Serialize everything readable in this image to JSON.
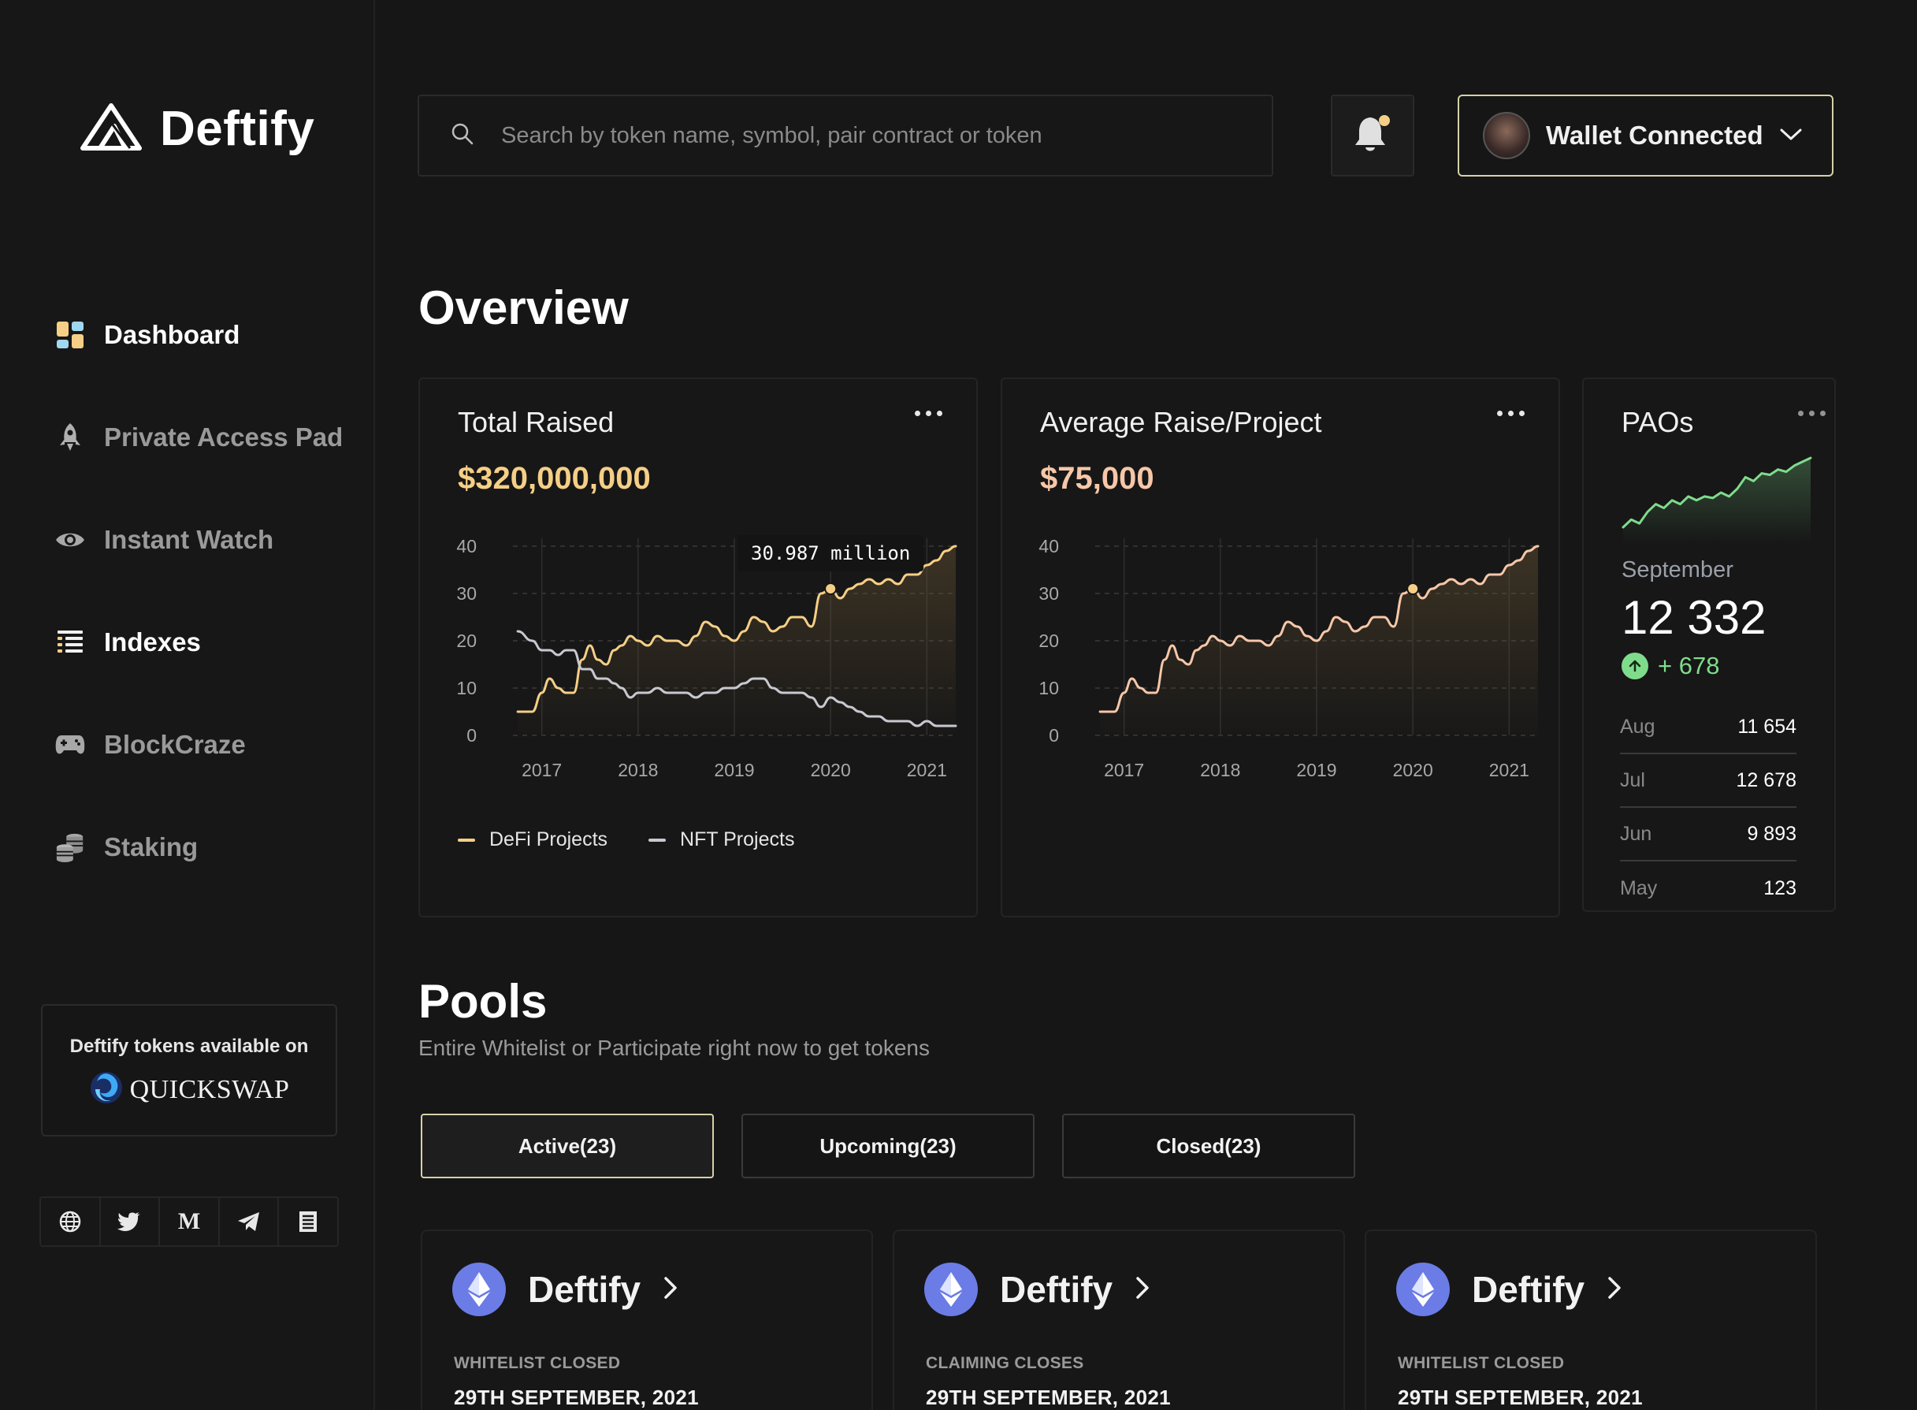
{
  "brand": {
    "name": "Deftify"
  },
  "search": {
    "placeholder": "Search by token name, symbol, pair contract or token"
  },
  "wallet": {
    "label": "Wallet Connected"
  },
  "nav": [
    {
      "label": "Dashboard",
      "icon": "dashboard-icon",
      "active": true
    },
    {
      "label": "Private Access Pad",
      "icon": "rocket-icon",
      "active": false
    },
    {
      "label": "Instant Watch",
      "icon": "eye-icon",
      "active": false
    },
    {
      "label": "Indexes",
      "icon": "list-icon",
      "active": true
    },
    {
      "label": "BlockCraze",
      "icon": "gamepad-icon",
      "active": false
    },
    {
      "label": "Staking",
      "icon": "coins-icon",
      "active": false
    }
  ],
  "promo": {
    "text": "Deftify tokens available on",
    "partner": "QUICKSWAP"
  },
  "socials": [
    "globe-icon",
    "twitter-icon",
    "medium-icon",
    "telegram-icon",
    "document-icon"
  ],
  "overview": {
    "title": "Overview",
    "total_raised": {
      "title": "Total Raised",
      "value": "$320,000,000",
      "tooltip": "30.987 million"
    },
    "avg_raise": {
      "title": "Average Raise/Project",
      "value": "$75,000"
    },
    "paos": {
      "title": "PAOs",
      "month": "September",
      "value": "12 332",
      "change": "+ 678",
      "rows": [
        {
          "month": "Aug",
          "value": "11 654"
        },
        {
          "month": "Jul",
          "value": "12 678"
        },
        {
          "month": "Jun",
          "value": "9 893"
        },
        {
          "month": "May",
          "value": "123"
        }
      ]
    }
  },
  "pools": {
    "title": "Pools",
    "subtitle": "Entire Whitelist or Participate right now to get tokens",
    "tabs": [
      {
        "label": "Active(23)",
        "active": true
      },
      {
        "label": "Upcoming(23)",
        "active": false
      },
      {
        "label": "Closed(23)",
        "active": false
      }
    ],
    "cards": [
      {
        "name": "Deftify",
        "status": "WHITELIST CLOSED",
        "date": "29TH SEPTEMBER, 2021"
      },
      {
        "name": "Deftify",
        "status": "CLAIMING CLOSES",
        "date": "29TH SEPTEMBER, 2021"
      },
      {
        "name": "Deftify",
        "status": "WHITELIST CLOSED",
        "date": "29TH SEPTEMBER, 2021"
      }
    ]
  },
  "colors": {
    "accent_gold": "#f5cf86",
    "accent_peach": "#f6c7a8",
    "line_nft": "#c8c8d0",
    "positive": "#7fdc8c",
    "eth_blue": "#6b7ce6"
  },
  "chart_data": [
    {
      "type": "line",
      "title": "Total Raised",
      "x": [
        2016.75,
        2016.9,
        2017.0,
        2017.08,
        2017.17,
        2017.25,
        2017.33,
        2017.42,
        2017.5,
        2017.58,
        2017.67,
        2017.75,
        2017.83,
        2017.92,
        2018.0,
        2018.1,
        2018.2,
        2018.3,
        2018.4,
        2018.5,
        2018.6,
        2018.7,
        2018.8,
        2018.9,
        2019.0,
        2019.1,
        2019.2,
        2019.3,
        2019.4,
        2019.5,
        2019.6,
        2019.7,
        2019.8,
        2019.9,
        2020.0,
        2020.1,
        2020.2,
        2020.3,
        2020.4,
        2020.5,
        2020.6,
        2020.7,
        2020.8,
        2020.9,
        2021.0,
        2021.1,
        2021.2,
        2021.3
      ],
      "series": [
        {
          "name": "DeFi Projects",
          "values": [
            5,
            5,
            9,
            12,
            10,
            9,
            9,
            16,
            19,
            16,
            15,
            18,
            19,
            21,
            20,
            19,
            21,
            20,
            20,
            19,
            21,
            24,
            23,
            21,
            20,
            22,
            25,
            24,
            22,
            23,
            25,
            25,
            23,
            30,
            31,
            29,
            31,
            32,
            33,
            32,
            33,
            32,
            34,
            34,
            36,
            37,
            39,
            40
          ]
        },
        {
          "name": "NFT Projects",
          "values": [
            22,
            20,
            18,
            18,
            17,
            18,
            18,
            14,
            14,
            12,
            12,
            11,
            10,
            8,
            9,
            9,
            10,
            9,
            9,
            9,
            8,
            9,
            9,
            10,
            10,
            11,
            12,
            12,
            10,
            9,
            9,
            9,
            8,
            6,
            8,
            7,
            6,
            5,
            4,
            4,
            3,
            3,
            3,
            2,
            3,
            2,
            2,
            2
          ]
        }
      ],
      "highlight": {
        "x": 2020.0,
        "y": 31,
        "label": "30.987 million"
      },
      "ylim": [
        0,
        40
      ],
      "yticks": [
        0,
        10,
        20,
        30,
        40
      ],
      "xticks": [
        2017,
        2018,
        2019,
        2020,
        2021
      ],
      "xlim": [
        2016.7,
        2021.3
      ],
      "grid": true,
      "legend": "bottom-left"
    },
    {
      "type": "area",
      "title": "Average Raise/Project",
      "x": [
        2016.75,
        2016.9,
        2017.0,
        2017.08,
        2017.17,
        2017.25,
        2017.33,
        2017.42,
        2017.5,
        2017.58,
        2017.67,
        2017.75,
        2017.83,
        2017.92,
        2018.0,
        2018.1,
        2018.2,
        2018.3,
        2018.4,
        2018.5,
        2018.6,
        2018.7,
        2018.8,
        2018.9,
        2019.0,
        2019.1,
        2019.2,
        2019.3,
        2019.4,
        2019.5,
        2019.6,
        2019.7,
        2019.8,
        2019.9,
        2020.0,
        2020.1,
        2020.2,
        2020.3,
        2020.4,
        2020.5,
        2020.6,
        2020.7,
        2020.8,
        2020.9,
        2021.0,
        2021.1,
        2021.2,
        2021.3
      ],
      "series": [
        {
          "values": [
            5,
            5,
            9,
            12,
            10,
            9,
            9,
            16,
            19,
            16,
            15,
            18,
            19,
            21,
            20,
            19,
            21,
            20,
            20,
            19,
            21,
            24,
            23,
            21,
            20,
            22,
            25,
            24,
            22,
            23,
            25,
            25,
            23,
            30,
            31,
            29,
            31,
            32,
            33,
            32,
            33,
            32,
            34,
            34,
            36,
            37,
            39,
            40
          ]
        }
      ],
      "highlight": {
        "x": 2020.0,
        "y": 31
      },
      "ylim": [
        0,
        40
      ],
      "yticks": [
        0,
        10,
        20,
        30,
        40
      ],
      "xticks": [
        2017,
        2018,
        2019,
        2020,
        2021
      ],
      "xlim": [
        2016.7,
        2021.3
      ],
      "grid": true
    },
    {
      "type": "line",
      "title": "PAOs",
      "x": [
        1,
        2,
        3,
        4,
        5,
        6,
        7,
        8,
        9,
        10,
        11,
        12,
        13,
        14,
        15,
        16,
        17,
        18,
        19,
        20,
        21,
        22,
        23,
        24
      ],
      "series": [
        {
          "values": [
            2,
            3,
            2.5,
            4,
            5,
            4.5,
            5.5,
            5,
            6,
            5.5,
            6,
            5.8,
            6.5,
            6,
            7,
            8.5,
            8,
            9,
            8.8,
            9.5,
            9.2,
            10,
            10.5,
            11
          ]
        }
      ],
      "grid": false
    }
  ]
}
